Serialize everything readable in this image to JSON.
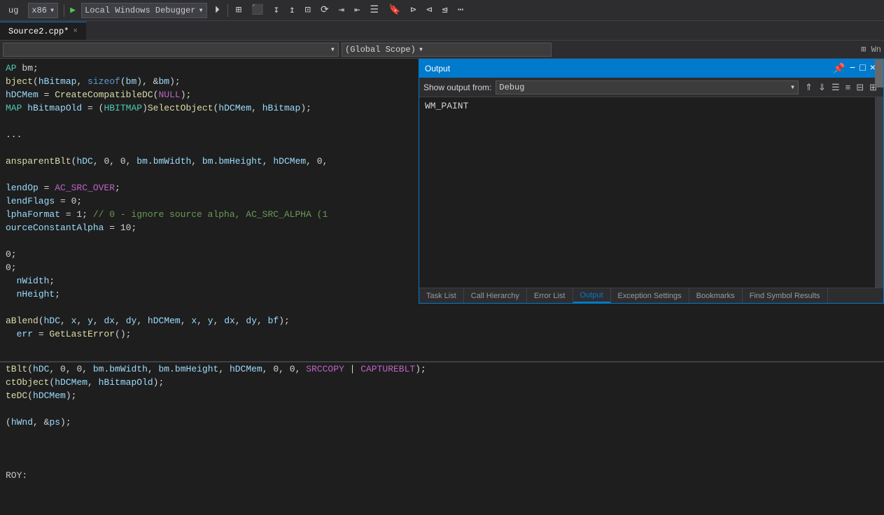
{
  "toolbar": {
    "debug_mode": "x86",
    "debugger_label": "Local Windows Debugger",
    "play_icon": "▶",
    "arrow_icon": "⏵"
  },
  "tabs": [
    {
      "label": "Source2.cpp",
      "modified": true,
      "active": true
    }
  ],
  "scope": {
    "dropdown1": "",
    "dropdown2": "(Global Scope)",
    "icon_window": "⊞ Wn"
  },
  "code_lines_top": [
    {
      "text": "AP bm;",
      "parts": [
        {
          "cls": "type",
          "t": "AP"
        },
        {
          "cls": "white",
          "t": " bm;"
        }
      ]
    },
    {
      "text": "bject(hBitmap, sizeof(bm), &bm);",
      "parts": [
        {
          "cls": "fn",
          "t": "bject"
        },
        {
          "cls": "white",
          "t": "("
        },
        {
          "cls": "var",
          "t": "hBitmap"
        },
        {
          "cls": "white",
          "t": ", "
        },
        {
          "cls": "kw",
          "t": "sizeof"
        },
        {
          "cls": "white",
          "t": "("
        },
        {
          "cls": "var",
          "t": "bm"
        },
        {
          "cls": "white",
          "t": "), &"
        },
        {
          "cls": "var",
          "t": "bm"
        },
        {
          "cls": "white",
          "t": ");"
        }
      ]
    },
    {
      "text": "hDCMem = CreateCompatibleDC(NULL);",
      "parts": [
        {
          "cls": "var",
          "t": "hDCMem"
        },
        {
          "cls": "white",
          "t": " = "
        },
        {
          "cls": "fn",
          "t": "CreateCompatibleDC"
        },
        {
          "cls": "white",
          "t": "("
        },
        {
          "cls": "macro",
          "t": "NULL"
        },
        {
          "cls": "white",
          "t": ");"
        }
      ]
    },
    {
      "text": "MAP hBitmapOld = (HBITMAP)SelectObject(hDCMem, hBitmap);",
      "parts": [
        {
          "cls": "type",
          "t": "MAP"
        },
        {
          "cls": "white",
          "t": " "
        },
        {
          "cls": "var",
          "t": "hBitmapOld"
        },
        {
          "cls": "white",
          "t": " = ("
        },
        {
          "cls": "type",
          "t": "HBITMAP"
        },
        {
          "cls": "white",
          "t": ")"
        },
        {
          "cls": "fn",
          "t": "SelectObject"
        },
        {
          "cls": "white",
          "t": "("
        },
        {
          "cls": "var",
          "t": "hDCMem"
        },
        {
          "cls": "white",
          "t": ", "
        },
        {
          "cls": "var",
          "t": "hBitmap"
        },
        {
          "cls": "white",
          "t": ");"
        }
      ]
    },
    {
      "text": ""
    },
    {
      "text": "...",
      "parts": [
        {
          "cls": "white",
          "t": "..."
        }
      ]
    },
    {
      "text": ""
    },
    {
      "text": "ansparentBlt(hDC, 0, 0, bm.bmWidth, bm.bmHeight, hDCMem, 0,",
      "parts": [
        {
          "cls": "fn",
          "t": "ansparentBlt"
        },
        {
          "cls": "white",
          "t": "("
        },
        {
          "cls": "var",
          "t": "hDC"
        },
        {
          "cls": "white",
          "t": ", 0, 0, "
        },
        {
          "cls": "var",
          "t": "bm"
        },
        {
          "cls": "white",
          "t": "."
        },
        {
          "cls": "var",
          "t": "bmWidth"
        },
        {
          "cls": "white",
          "t": ", "
        },
        {
          "cls": "var",
          "t": "bm"
        },
        {
          "cls": "white",
          "t": "."
        },
        {
          "cls": "var",
          "t": "bmHeight"
        },
        {
          "cls": "white",
          "t": ", "
        },
        {
          "cls": "var",
          "t": "hDCMem"
        },
        {
          "cls": "white",
          "t": ", 0,"
        }
      ]
    },
    {
      "text": ""
    },
    {
      "text": "lendOp = AC_SRC_OVER;",
      "parts": [
        {
          "cls": "var",
          "t": "lendOp"
        },
        {
          "cls": "white",
          "t": " = "
        },
        {
          "cls": "macro",
          "t": "AC_SRC_OVER"
        },
        {
          "cls": "white",
          "t": ";"
        }
      ]
    },
    {
      "text": "lendFlags = 0;",
      "parts": [
        {
          "cls": "var",
          "t": "lendFlags"
        },
        {
          "cls": "white",
          "t": " = 0;"
        }
      ]
    },
    {
      "text": "lphaFormat = 1; // 0 - ignore source alpha, AC_SRC_ALPHA (1",
      "parts": [
        {
          "cls": "var",
          "t": "lphaFormat"
        },
        {
          "cls": "white",
          "t": " = 1; "
        },
        {
          "cls": "cmt",
          "t": "// 0 - ignore source alpha, AC_SRC_ALPHA (1"
        }
      ]
    },
    {
      "text": "ourceConstantAlpha = 10;",
      "parts": [
        {
          "cls": "var",
          "t": "ourceConstantAlpha"
        },
        {
          "cls": "white",
          "t": " = 10;"
        }
      ]
    },
    {
      "text": ""
    },
    {
      "text": "0;",
      "parts": [
        {
          "cls": "white",
          "t": "0;"
        }
      ]
    },
    {
      "text": "0;",
      "parts": [
        {
          "cls": "white",
          "t": "0;"
        }
      ]
    },
    {
      "text": "  nWidth;",
      "parts": [
        {
          "cls": "white",
          "t": "  "
        },
        {
          "cls": "var",
          "t": "nWidth"
        },
        {
          "cls": "white",
          "t": ";"
        }
      ]
    },
    {
      "text": "  nHeight;",
      "parts": [
        {
          "cls": "white",
          "t": "  "
        },
        {
          "cls": "var",
          "t": "nHeight"
        },
        {
          "cls": "white",
          "t": ";"
        }
      ]
    },
    {
      "text": ""
    },
    {
      "text": "aBlend(hDC, x, y, dx, dy, hDCMem, x, y, dx, dy, bf);",
      "parts": [
        {
          "cls": "fn",
          "t": "aBlend"
        },
        {
          "cls": "white",
          "t": "("
        },
        {
          "cls": "var",
          "t": "hDC"
        },
        {
          "cls": "white",
          "t": ", "
        },
        {
          "cls": "var",
          "t": "x"
        },
        {
          "cls": "white",
          "t": ", "
        },
        {
          "cls": "var",
          "t": "y"
        },
        {
          "cls": "white",
          "t": ", "
        },
        {
          "cls": "var",
          "t": "dx"
        },
        {
          "cls": "white",
          "t": ", "
        },
        {
          "cls": "var",
          "t": "dy"
        },
        {
          "cls": "white",
          "t": ", "
        },
        {
          "cls": "var",
          "t": "hDCMem"
        },
        {
          "cls": "white",
          "t": ", "
        },
        {
          "cls": "var",
          "t": "x"
        },
        {
          "cls": "white",
          "t": ", "
        },
        {
          "cls": "var",
          "t": "y"
        },
        {
          "cls": "white",
          "t": ", "
        },
        {
          "cls": "var",
          "t": "dx"
        },
        {
          "cls": "white",
          "t": ", "
        },
        {
          "cls": "var",
          "t": "dy"
        },
        {
          "cls": "white",
          "t": ", "
        },
        {
          "cls": "var",
          "t": "bf"
        },
        {
          "cls": "white",
          "t": ");"
        }
      ]
    },
    {
      "text": "  err = GetLastError();",
      "parts": [
        {
          "cls": "white",
          "t": "  "
        },
        {
          "cls": "var",
          "t": "err"
        },
        {
          "cls": "white",
          "t": " = "
        },
        {
          "cls": "fn",
          "t": "GetLastError"
        },
        {
          "cls": "white",
          "t": "();"
        }
      ]
    }
  ],
  "code_lines_bottom": [
    {
      "text": "tBlt(hDC, 0, 0, bm.bmWidth, bm.bmHeight, hDCMem, 0, 0, SRCCOPY | CAPTUREBLT);",
      "parts": [
        {
          "cls": "fn",
          "t": "tBlt"
        },
        {
          "cls": "white",
          "t": "("
        },
        {
          "cls": "var",
          "t": "hDC"
        },
        {
          "cls": "white",
          "t": ", 0, 0, "
        },
        {
          "cls": "var",
          "t": "bm"
        },
        {
          "cls": "white",
          "t": "."
        },
        {
          "cls": "var",
          "t": "bmWidth"
        },
        {
          "cls": "white",
          "t": ", "
        },
        {
          "cls": "var",
          "t": "bm"
        },
        {
          "cls": "white",
          "t": "."
        },
        {
          "cls": "var",
          "t": "bmHeight"
        },
        {
          "cls": "white",
          "t": ", "
        },
        {
          "cls": "var",
          "t": "hDCMem"
        },
        {
          "cls": "white",
          "t": ", 0, 0, "
        },
        {
          "cls": "macro",
          "t": "SRCCOPY"
        },
        {
          "cls": "white",
          "t": " | "
        },
        {
          "cls": "macro",
          "t": "CAPTUREBLT"
        },
        {
          "cls": "white",
          "t": ");"
        }
      ]
    },
    {
      "text": "ctObject(hDCMem, hBitmapOld);",
      "parts": [
        {
          "cls": "fn",
          "t": "ctObject"
        },
        {
          "cls": "white",
          "t": "("
        },
        {
          "cls": "var",
          "t": "hDCMem"
        },
        {
          "cls": "white",
          "t": ", "
        },
        {
          "cls": "var",
          "t": "hBitmapOld"
        },
        {
          "cls": "white",
          "t": ");"
        }
      ]
    },
    {
      "text": "teDC(hDCMem);",
      "parts": [
        {
          "cls": "fn",
          "t": "teDC"
        },
        {
          "cls": "white",
          "t": "("
        },
        {
          "cls": "var",
          "t": "hDCMem"
        },
        {
          "cls": "white",
          "t": ");"
        }
      ]
    },
    {
      "text": ""
    },
    {
      "text": "(hWnd, &ps);",
      "parts": [
        {
          "cls": "white",
          "t": "("
        },
        {
          "cls": "var",
          "t": "hWnd"
        },
        {
          "cls": "white",
          "t": ", &"
        },
        {
          "cls": "var",
          "t": "ps"
        },
        {
          "cls": "white",
          "t": ");"
        }
      ]
    },
    {
      "text": ""
    },
    {
      "text": ""
    },
    {
      "text": ""
    },
    {
      "text": "ROY:",
      "parts": [
        {
          "cls": "label",
          "t": "ROY:"
        }
      ]
    }
  ],
  "output_panel": {
    "title": "Output",
    "show_output_label": "Show output from:",
    "selected_source": "Debug",
    "content_line": "WM_PAINT",
    "minimize_icon": "−",
    "maximize_icon": "□",
    "close_icon": "×"
  },
  "bottom_tabs": [
    {
      "label": "Task List",
      "active": false
    },
    {
      "label": "Call Hierarchy",
      "active": false
    },
    {
      "label": "Error List",
      "active": false
    },
    {
      "label": "Output",
      "active": true
    },
    {
      "label": "Exception Settings",
      "active": false
    },
    {
      "label": "Bookmarks",
      "active": false
    },
    {
      "label": "Find Symbol Results",
      "active": false
    }
  ]
}
